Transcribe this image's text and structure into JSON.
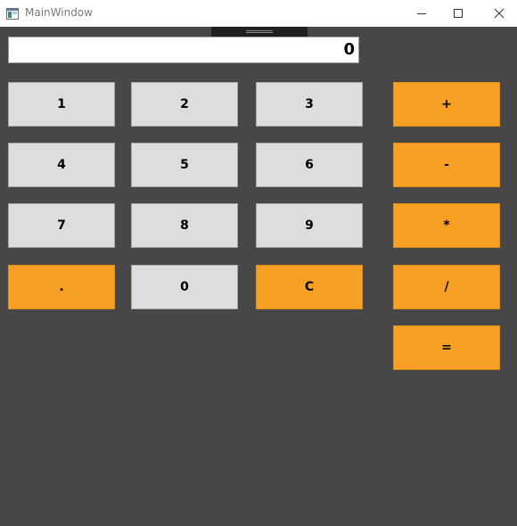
{
  "window": {
    "title": "MainWindow",
    "icon": "app-window-icon"
  },
  "controls": {
    "minimize_icon": "minimize-icon",
    "maximize_icon": "maximize-icon",
    "close_icon": "close-icon"
  },
  "display": {
    "value": "0"
  },
  "keys": {
    "one": "1",
    "two": "2",
    "three": "3",
    "four": "4",
    "five": "5",
    "six": "6",
    "seven": "7",
    "eight": "8",
    "nine": "9",
    "zero": "0",
    "decimal": ".",
    "clear": "C",
    "add": "+",
    "subtract": "-",
    "multiply": "*",
    "divide": "/",
    "equals": "="
  },
  "colors": {
    "background": "#474747",
    "digit_key": "#dddddd",
    "accent_key": "#f7a024",
    "display": "#ffffff"
  }
}
